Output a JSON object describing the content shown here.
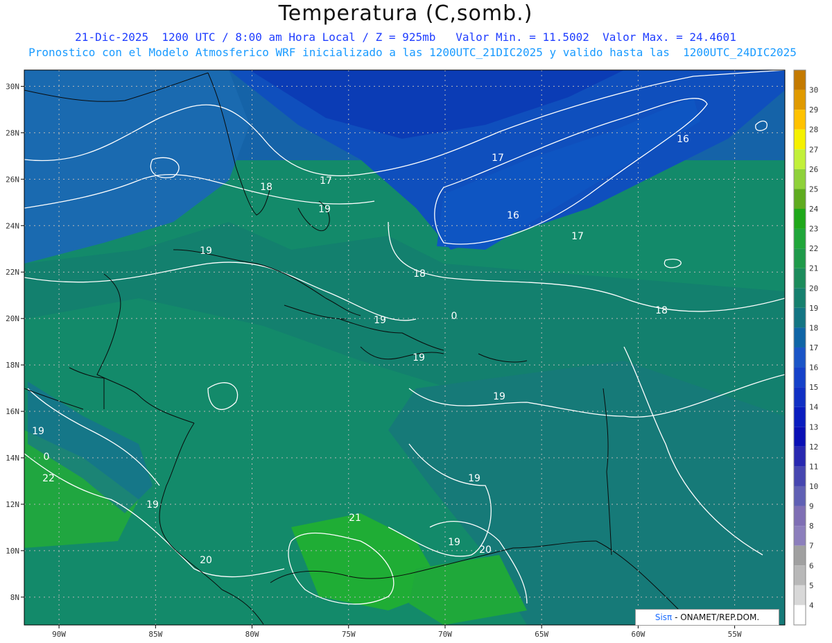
{
  "title": "Temperatura (C,somb.)",
  "subtitle_line1": "21-Dic-2025  1200 UTC / 8:00 am Hora Local / Z = 925mb   Valor Min. = 11.5002  Valor Max. = 24.4601",
  "subtitle_line2": "Pronostico con el Modelo Atmosferico WRF inicializado a las 1200UTC_21DIC2025 y valido hasta las  1200UTC_24DIC2025",
  "credit_brand": "Sisπ",
  "credit_text": " - ONAMET/REP.DOM.",
  "lon_ticks": [
    "90W",
    "85W",
    "80W",
    "75W",
    "70W",
    "65W",
    "60W",
    "55W"
  ],
  "lat_ticks": [
    "30N",
    "28N",
    "26N",
    "24N",
    "22N",
    "20N",
    "18N",
    "16N",
    "14N",
    "12N",
    "10N",
    "8N"
  ],
  "colorbar": {
    "labels": [
      "30",
      "29",
      "28",
      "27",
      "26",
      "25",
      "24",
      "23",
      "22",
      "21",
      "20",
      "19",
      "18",
      "17",
      "16",
      "15",
      "14",
      "13",
      "12",
      "11",
      "10",
      "9",
      "8",
      "7",
      "6",
      "5",
      "4"
    ],
    "colors": [
      "#c47a00",
      "#e09a00",
      "#ffc200",
      "#f5f100",
      "#c2f03a",
      "#8fd13a",
      "#5fab1f",
      "#1fa81a",
      "#20a63a",
      "#1f9a4a",
      "#1c8c5c",
      "#16806e",
      "#137583",
      "#0f65a6",
      "#1a55c7",
      "#1541c9",
      "#1030c4",
      "#0a1dbf",
      "#0a10b5",
      "#2828b0",
      "#4646b0",
      "#6060b4",
      "#7f6fb4",
      "#8c7fbc",
      "#a0a0a0",
      "#b8b8b8",
      "#d8d8d8",
      "#ffffff"
    ]
  },
  "contour_labels": [
    "16",
    "16",
    "17",
    "17",
    "17",
    "18",
    "18",
    "18",
    "19",
    "19",
    "19",
    "19",
    "19",
    "19",
    "19",
    "19",
    "19",
    "20",
    "20",
    "0",
    "0",
    "21",
    "22"
  ]
}
